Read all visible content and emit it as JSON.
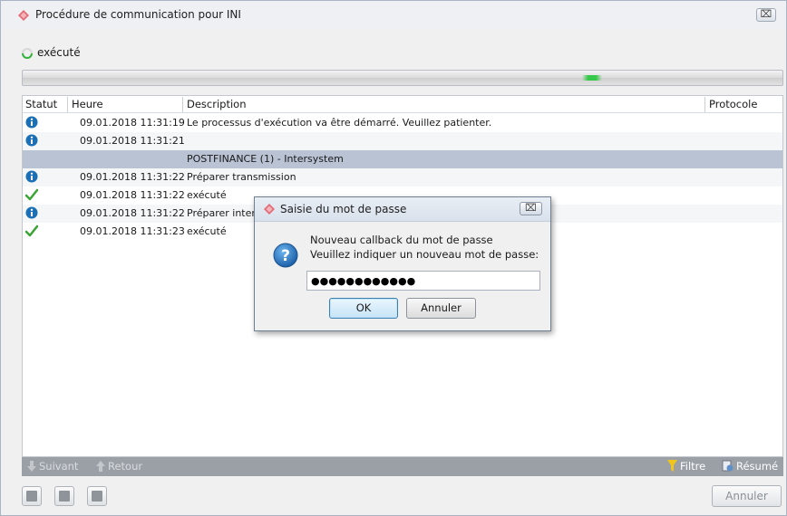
{
  "window": {
    "title": "Procédure de communication pour INI",
    "close_symbol": "⌧",
    "icon": "diamond-logo-icon"
  },
  "status": {
    "text": "exécuté",
    "icon": "loading-spinner-icon"
  },
  "progress": {
    "style": "indeterminate-marquee",
    "fill_color": "#36c84a"
  },
  "grid": {
    "columns": [
      "Statut",
      "Heure",
      "Description",
      "Protocole"
    ],
    "rows": [
      {
        "type": "entry",
        "icon": "info-icon",
        "time": "09.01.2018 11:31:19",
        "description": "Le processus d'exécution va être démarré. Veuillez patienter."
      },
      {
        "type": "entry",
        "icon": "info-icon",
        "time": "09.01.2018 11:31:21",
        "description": ""
      },
      {
        "type": "group",
        "icon": "",
        "time": "",
        "description": "POSTFINANCE (1) - Intersystem"
      },
      {
        "type": "entry",
        "icon": "info-icon",
        "time": "09.01.2018 11:31:22",
        "description": "Préparer transmission"
      },
      {
        "type": "entry",
        "icon": "checkmark-icon",
        "time": "09.01.2018 11:31:22",
        "description": "exécuté"
      },
      {
        "type": "entry",
        "icon": "info-icon",
        "time": "09.01.2018 11:31:22",
        "description": "Préparer inter"
      },
      {
        "type": "entry",
        "icon": "checkmark-icon",
        "time": "09.01.2018 11:31:23",
        "description": "exécuté"
      }
    ]
  },
  "footer": {
    "next_label": "Suivant",
    "back_label": "Retour",
    "filter_label": "Filtre",
    "summary_label": "Résumé"
  },
  "bottom": {
    "cancel_label": "Annuler",
    "tool_icons": [
      "copy-icon",
      "save-icon",
      "print-icon"
    ]
  },
  "dialog": {
    "title": "Saisie du mot de passe",
    "close_symbol": "⌧",
    "message_line1": "Nouveau callback du mot de passe",
    "message_line2": "Veuillez indiquer un nouveau mot de passe:",
    "password_value": "●●●●●●●●●●●●",
    "ok_label": "OK",
    "cancel_label": "Annuler",
    "icon": "question-icon"
  },
  "colors": {
    "group_row": "#b9c3d4",
    "info_blue": "#1a6fb5",
    "check_green": "#3aa535",
    "footer_bar": "#9aa0a6"
  }
}
